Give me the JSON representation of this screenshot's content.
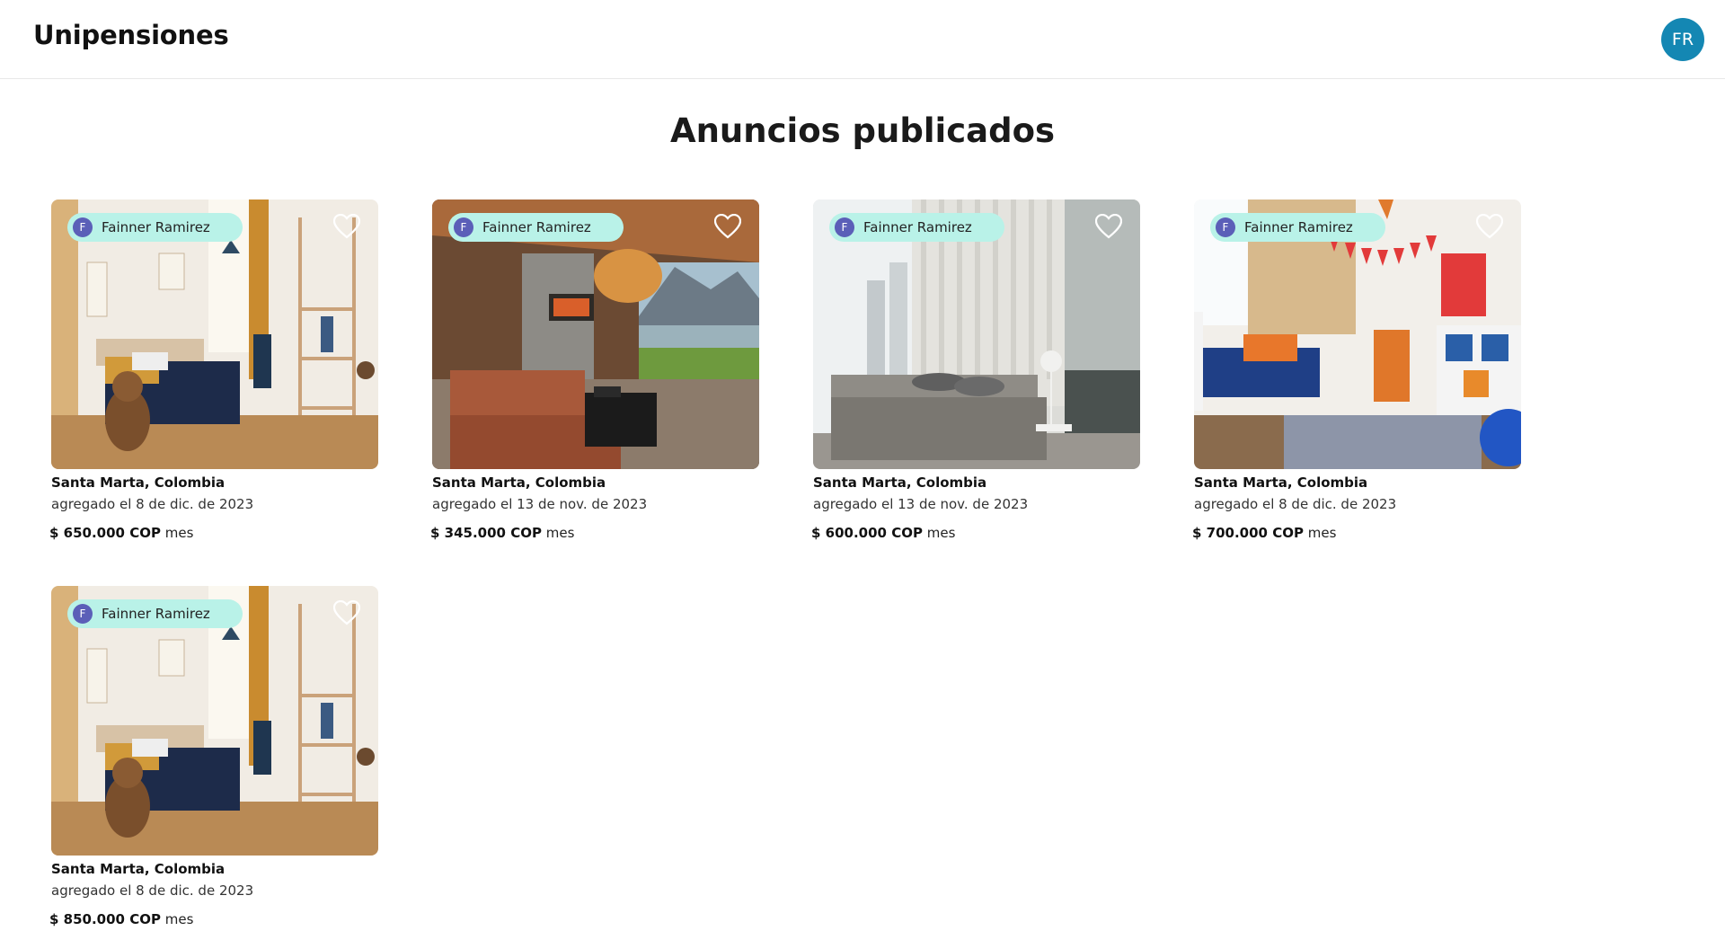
{
  "app": {
    "title": "Unipensiones",
    "user_initials": "FR"
  },
  "page": {
    "title": "Anuncios publicados"
  },
  "colors": {
    "avatar_bg": "#1487b3",
    "owner_chip_bg": "#b9f2e8",
    "owner_initial_bg": "#5b5fb8"
  },
  "listings": [
    {
      "owner_name": "Fainner Ramirez",
      "owner_initial": "F",
      "location": "Santa Marta, Colombia",
      "date": "agregado el 8 de dic. de 2023",
      "price": "$ 650.000 COP",
      "period": "mes",
      "photo": "kids-bedroom-teddy-bear"
    },
    {
      "owner_name": "Fainner Ramirez",
      "owner_initial": "F",
      "location": "Santa Marta, Colombia",
      "date": "agregado el 13 de nov. de 2023",
      "price": "$ 345.000 COP",
      "period": "mes",
      "photo": "living-room-lake-view"
    },
    {
      "owner_name": "Fainner Ramirez",
      "owner_initial": "F",
      "location": "Santa Marta, Colombia",
      "date": "agregado el 13 de nov. de 2023",
      "price": "$ 600.000 COP",
      "period": "mes",
      "photo": "grey-modern-bedroom"
    },
    {
      "owner_name": "Fainner Ramirez",
      "owner_initial": "F",
      "location": "Santa Marta, Colombia",
      "date": "agregado el 8 de dic. de 2023",
      "price": "$ 700.000 COP",
      "period": "mes",
      "photo": "kids-room-blue-bed"
    },
    {
      "owner_name": "Fainner Ramirez",
      "owner_initial": "F",
      "location": "Santa Marta, Colombia",
      "date": "agregado el 8 de dic. de 2023",
      "price": "$ 850.000 COP",
      "period": "mes",
      "photo": "kids-bedroom-teddy-bear"
    }
  ]
}
